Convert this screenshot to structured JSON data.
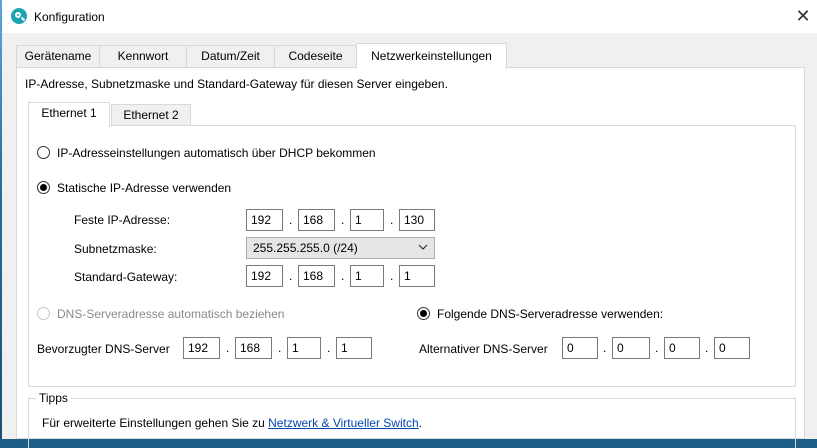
{
  "window": {
    "title": "Konfiguration",
    "close_glyph": "✕"
  },
  "tabs": [
    {
      "label": "Gerätename"
    },
    {
      "label": "Kennwort"
    },
    {
      "label": "Datum/Zeit"
    },
    {
      "label": "Codeseite"
    },
    {
      "label": "Netzwerkeinstellungen",
      "active": true
    }
  ],
  "description": "IP-Adresse, Subnetzmaske und Standard-Gateway für diesen Server eingeben.",
  "subtabs": [
    {
      "label": "Ethernet 1",
      "active": true
    },
    {
      "label": "Ethernet 2"
    }
  ],
  "ip": {
    "dhcp_label": "IP-Adresseinstellungen automatisch über DHCP bekommen",
    "static_label": "Statische IP-Adresse verwenden",
    "fixed_ip_label": "Feste IP-Adresse:",
    "fixed_ip": [
      "192",
      "168",
      "1",
      "130"
    ],
    "subnet_label": "Subnetzmaske:",
    "subnet_value": "255.255.255.0 (/24)",
    "gateway_label": "Standard-Gateway:",
    "gateway": [
      "192",
      "168",
      "1",
      "1"
    ]
  },
  "dns": {
    "auto_label": "DNS-Serveradresse automatisch beziehen",
    "manual_label": "Folgende DNS-Serveradresse verwenden:",
    "preferred_label": "Bevorzugter DNS-Server",
    "preferred": [
      "192",
      "168",
      "1",
      "1"
    ],
    "alternate_label": "Alternativer DNS-Server",
    "alternate": [
      "0",
      "0",
      "0",
      "0"
    ]
  },
  "tips": {
    "title": "Tipps",
    "text_prefix": "Für erweiterte Einstellungen gehen Sie zu ",
    "link": "Netzwerk & Virtueller Switch",
    "text_suffix": "."
  },
  "separator": "."
}
